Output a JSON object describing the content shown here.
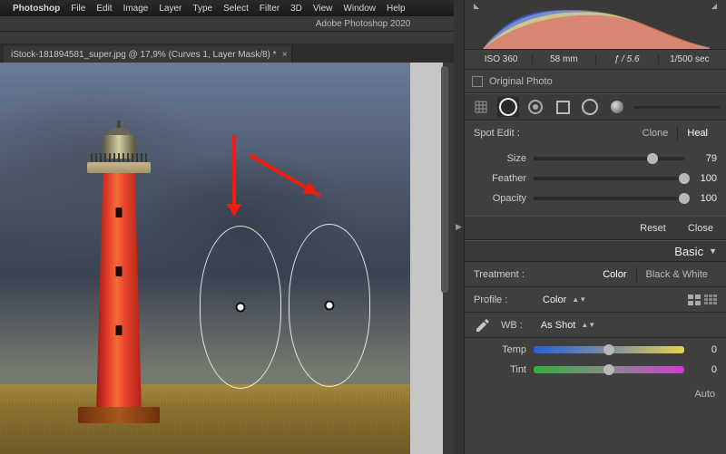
{
  "menubar": {
    "app": "Photoshop",
    "items": [
      "File",
      "Edit",
      "Image",
      "Layer",
      "Type",
      "Select",
      "Filter",
      "3D",
      "View",
      "Window",
      "Help"
    ]
  },
  "titlebar": {
    "title": "Adobe Photoshop 2020"
  },
  "tab": {
    "label": "iStock-181894581_super.jpg @ 17,9% (Curves 1, Layer Mask/8) *"
  },
  "histogram": {
    "meta": {
      "iso": "ISO 360",
      "focal": "58 mm",
      "aperture": "ƒ / 5.6",
      "shutter": "1/500 sec"
    },
    "original_label": "Original Photo"
  },
  "spot_panel": {
    "title": "Spot Edit :",
    "modes": {
      "clone": "Clone",
      "heal": "Heal",
      "selected": "heal"
    },
    "sliders": {
      "size": {
        "label": "Size",
        "value": "79",
        "pct": 79
      },
      "feather": {
        "label": "Feather",
        "value": "100",
        "pct": 100
      },
      "opacity": {
        "label": "Opacity",
        "value": "100",
        "pct": 100
      }
    },
    "reset": "Reset",
    "close": "Close"
  },
  "basic_panel": {
    "title": "Basic",
    "treatment": {
      "label": "Treatment :",
      "color": "Color",
      "bw": "Black & White",
      "selected": "color"
    },
    "profile": {
      "label": "Profile :",
      "value": "Color"
    },
    "wb": {
      "label": "WB :",
      "value": "As Shot"
    },
    "temp": {
      "label": "Temp",
      "value": "0",
      "pct": 50
    },
    "tint": {
      "label": "Tint",
      "value": "0",
      "pct": 50
    },
    "auto": "Auto"
  }
}
